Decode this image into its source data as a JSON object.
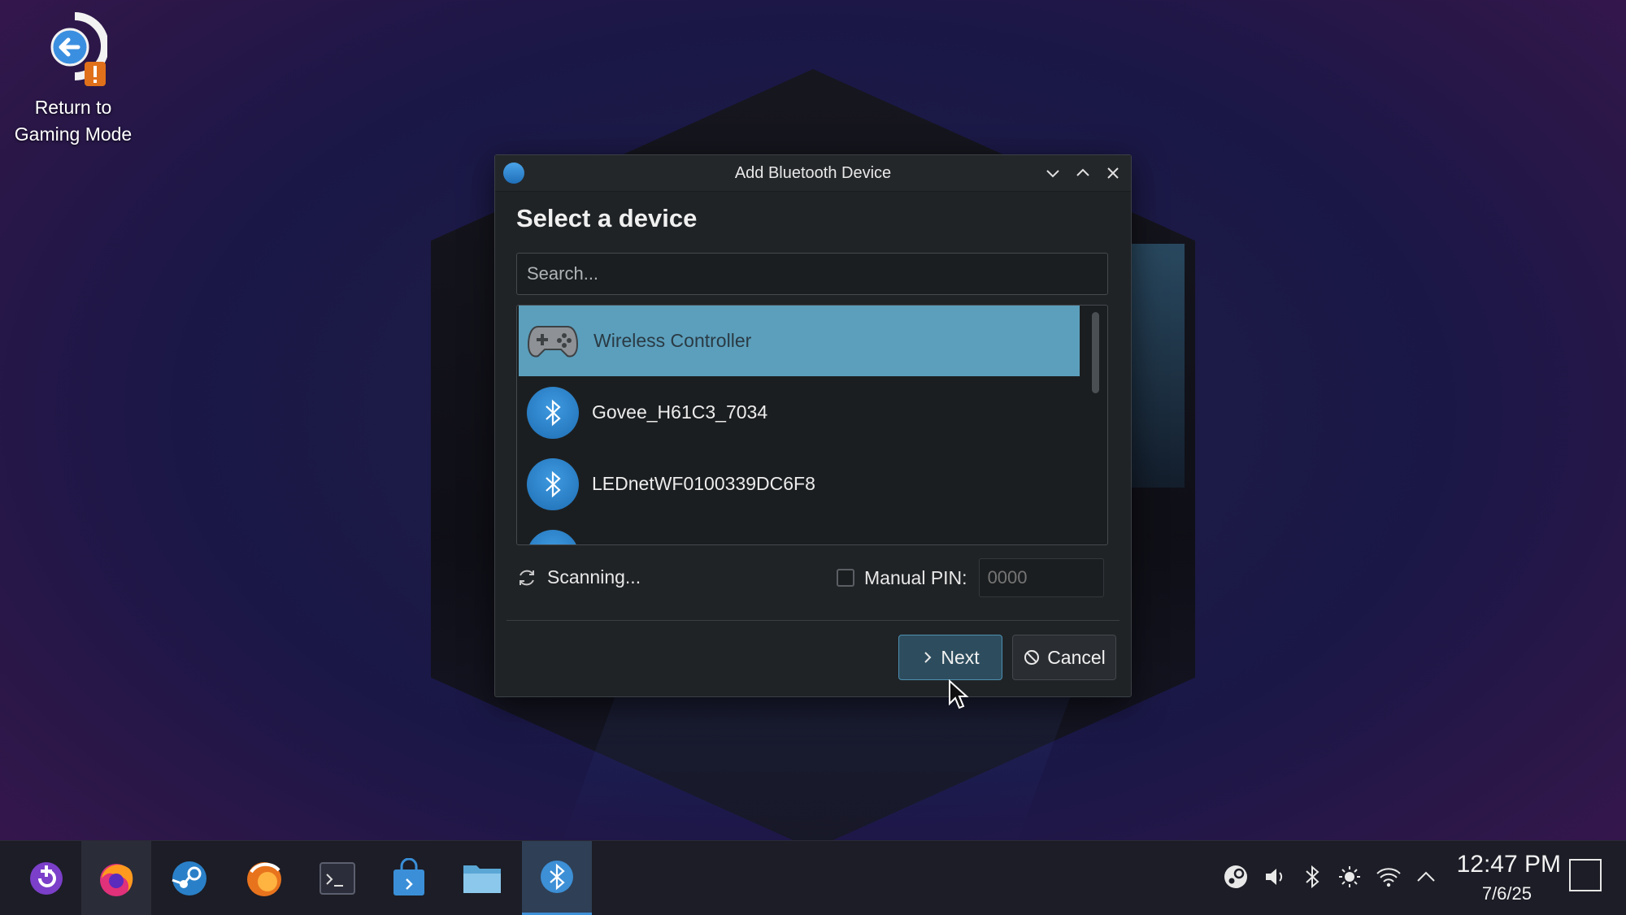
{
  "desktop": {
    "icon_label_line1": "Return to",
    "icon_label_line2": "Gaming Mode"
  },
  "dialog": {
    "title": "Add Bluetooth Device",
    "heading": "Select a device",
    "search_placeholder": "Search...",
    "devices": [
      {
        "label": "Wireless Controller",
        "icon": "gamepad-icon",
        "selected": true
      },
      {
        "label": "Govee_H61C3_7034",
        "icon": "bluetooth-icon",
        "selected": false
      },
      {
        "label": "LEDnetWF0100339DC6F8",
        "icon": "bluetooth-icon",
        "selected": false
      }
    ],
    "scanning_text": "Scanning...",
    "manual_pin_label": "Manual PIN:",
    "pin_placeholder": "0000",
    "next_label": "Next",
    "cancel_label": "Cancel"
  },
  "taskbar": {
    "apps": [
      "discover-icon",
      "firefox-icon",
      "steam-icon",
      "app-icon",
      "terminal-icon",
      "store-icon",
      "file-manager-icon",
      "bluetooth-icon"
    ],
    "tray": [
      "steam-tray-icon",
      "volume-icon",
      "bluetooth-tray-icon",
      "brightness-icon",
      "wifi-icon",
      "chevron-up-icon"
    ],
    "time": "12:47 PM",
    "date": "7/6/25"
  },
  "colors": {
    "selection": "#5b9fbc",
    "accent": "#3d8fd6",
    "dialog_bg": "#202326"
  }
}
